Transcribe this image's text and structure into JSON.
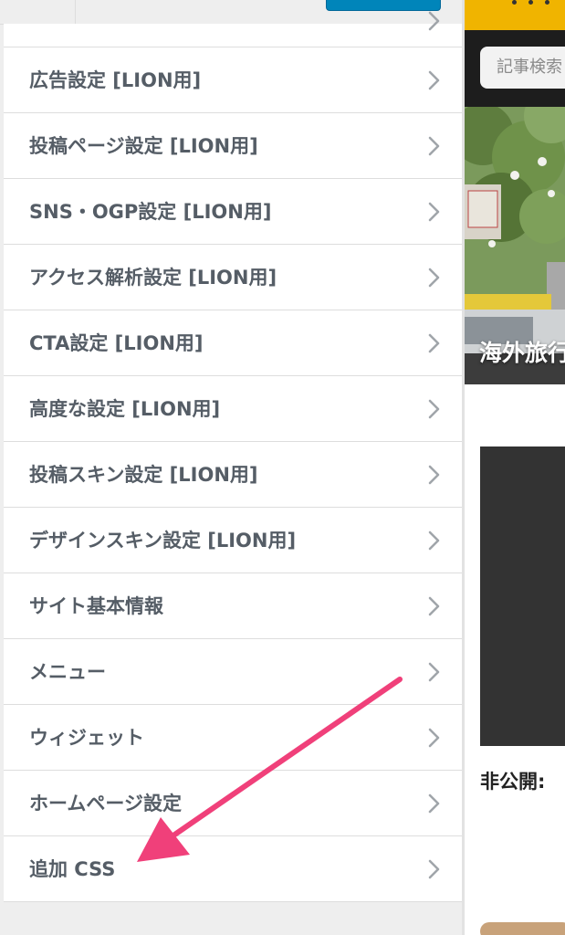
{
  "customizer": {
    "sections": [
      {
        "label": "広告設定 [LION用]"
      },
      {
        "label": "投稿ページ設定 [LION用]"
      },
      {
        "label": "SNS・OGP設定 [LION用]"
      },
      {
        "label": "アクセス解析設定 [LION用]"
      },
      {
        "label": "CTA設定 [LION用]"
      },
      {
        "label": "高度な設定 [LION用]"
      },
      {
        "label": "投稿スキン設定 [LION用]"
      },
      {
        "label": "デザインスキン設定 [LION用]"
      },
      {
        "label": "サイト基本情報"
      },
      {
        "label": "メニュー"
      },
      {
        "label": "ウィジェット"
      },
      {
        "label": "ホームページ設定"
      },
      {
        "label": "追加 CSS"
      }
    ],
    "chevron_icon": "chevron-right-icon"
  },
  "preview": {
    "search_placeholder": "記事検索",
    "hero_title": "海外旅行",
    "private_label": "非公開:",
    "header_color": "#f0b400"
  },
  "annotation": {
    "arrow_color": "#f0407a",
    "icon": "arrow-icon"
  }
}
